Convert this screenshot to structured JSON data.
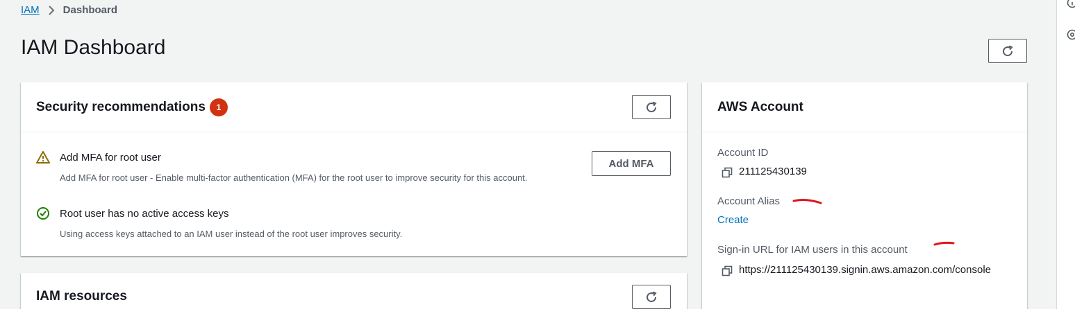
{
  "breadcrumb": {
    "root": "IAM",
    "current": "Dashboard"
  },
  "page": {
    "title": "IAM Dashboard"
  },
  "security": {
    "title": "Security recommendations",
    "badge_count": "1",
    "items": [
      {
        "icon": "warning-icon",
        "title": "Add MFA for root user",
        "description": "Add MFA for root user - Enable multi-factor authentication (MFA) for the root user to improve security for this account.",
        "action_label": "Add MFA"
      },
      {
        "icon": "check-circle-icon",
        "title": "Root user has no active access keys",
        "description": "Using access keys attached to an IAM user instead of the root user improves security."
      }
    ]
  },
  "resources": {
    "title": "IAM resources"
  },
  "account": {
    "title": "AWS Account",
    "account_id_label": "Account ID",
    "account_id": "211125430139",
    "alias_label": "Account Alias",
    "alias_create": "Create",
    "signin_label": "Sign-in URL for IAM users in this account",
    "signin_url": "https://211125430139.signin.aws.amazon.com/console"
  },
  "colors": {
    "background": "#f2f3f3",
    "link": "#0073bb",
    "badge": "#d13212",
    "warning": "#8a6d00",
    "success": "#1d8102",
    "annotation": "#e0141e"
  }
}
